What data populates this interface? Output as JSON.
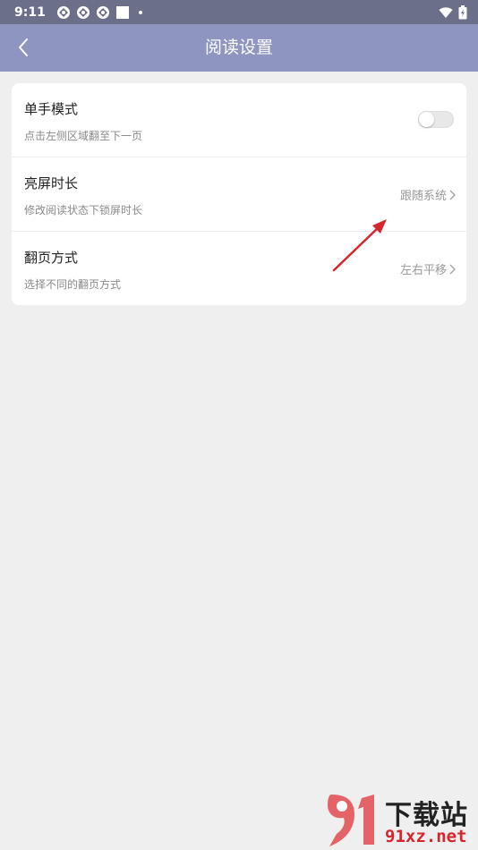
{
  "status_bar": {
    "time": "9:11",
    "notification_icons": [
      "sync-icon",
      "sync-icon",
      "sync-icon",
      "square-icon",
      "dot-icon"
    ],
    "right_icons": [
      "wifi-icon",
      "battery-charging-icon"
    ]
  },
  "app_bar": {
    "title": "阅读设置",
    "back_icon": "chevron-left-icon",
    "background": "#8e95c1"
  },
  "settings": {
    "items": [
      {
        "title": "单手模式",
        "subtitle": "点击左侧区域翻至下一页",
        "control": "toggle",
        "toggle_on": false
      },
      {
        "title": "亮屏时长",
        "subtitle": "修改阅读状态下锁屏时长",
        "control": "value",
        "value": "跟随系统"
      },
      {
        "title": "翻页方式",
        "subtitle": "选择不同的翻页方式",
        "control": "value",
        "value": "左右平移"
      }
    ]
  },
  "annotation": {
    "type": "arrow",
    "color": "#d6262d"
  },
  "watermark": {
    "logo_text": "91",
    "title": "下载站",
    "url": "91xz.net",
    "accent": "#d6262d"
  }
}
